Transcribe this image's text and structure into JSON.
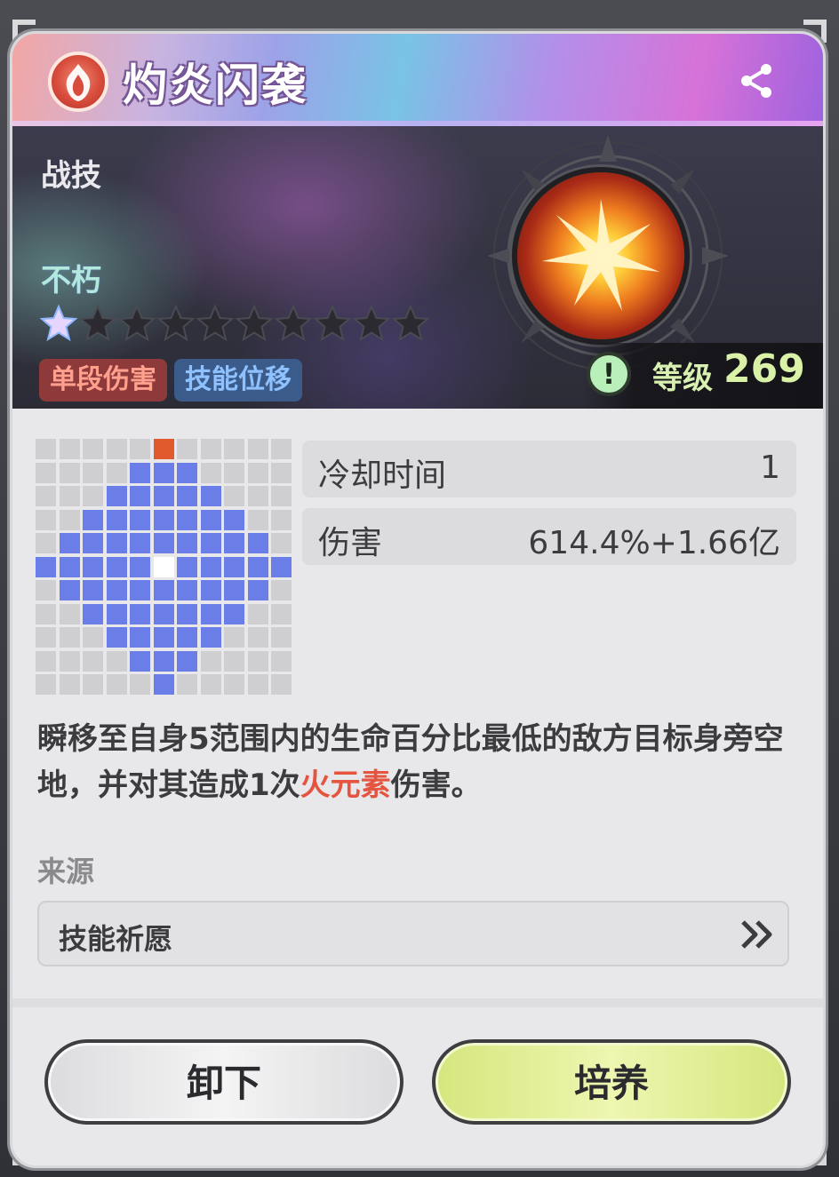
{
  "header": {
    "title": "灼炎闪袭",
    "emblem_icon": "flame-emblem-icon",
    "share_icon": "share-icon"
  },
  "banner": {
    "skill_type": "战技",
    "quality": "不朽",
    "stars_total": 10,
    "stars_filled": 1,
    "tags": [
      "单段伤害",
      "技能位移"
    ],
    "level_label": "等级",
    "level_value": "269",
    "warning_icon": "!",
    "skill_icon": "fire-explosion-icon"
  },
  "range_grid": {
    "rows": 11,
    "cols": 11,
    "cells": [
      "0000050000",
      "0000000000"
    ],
    "colors": {
      "empty": "#cfcfd2",
      "range": "#6b7de6",
      "self": "#ffffff",
      "target": "#e05a2d"
    }
  },
  "stats": [
    {
      "label": "冷却时间",
      "value": "1"
    },
    {
      "label": "伤害",
      "value": "614.4%+1.66亿"
    }
  ],
  "description": {
    "part1": "瞬移至自身5范围内的生命百分比最低的敌方目标身旁空地，并对其造成1次",
    "highlight": "火元素",
    "part2": "伤害。"
  },
  "source": {
    "label": "来源",
    "name": "技能祈愿",
    "arrow_icon": "double-chevron-right-icon"
  },
  "buttons": {
    "unequip": "卸下",
    "cultivate": "培养"
  }
}
